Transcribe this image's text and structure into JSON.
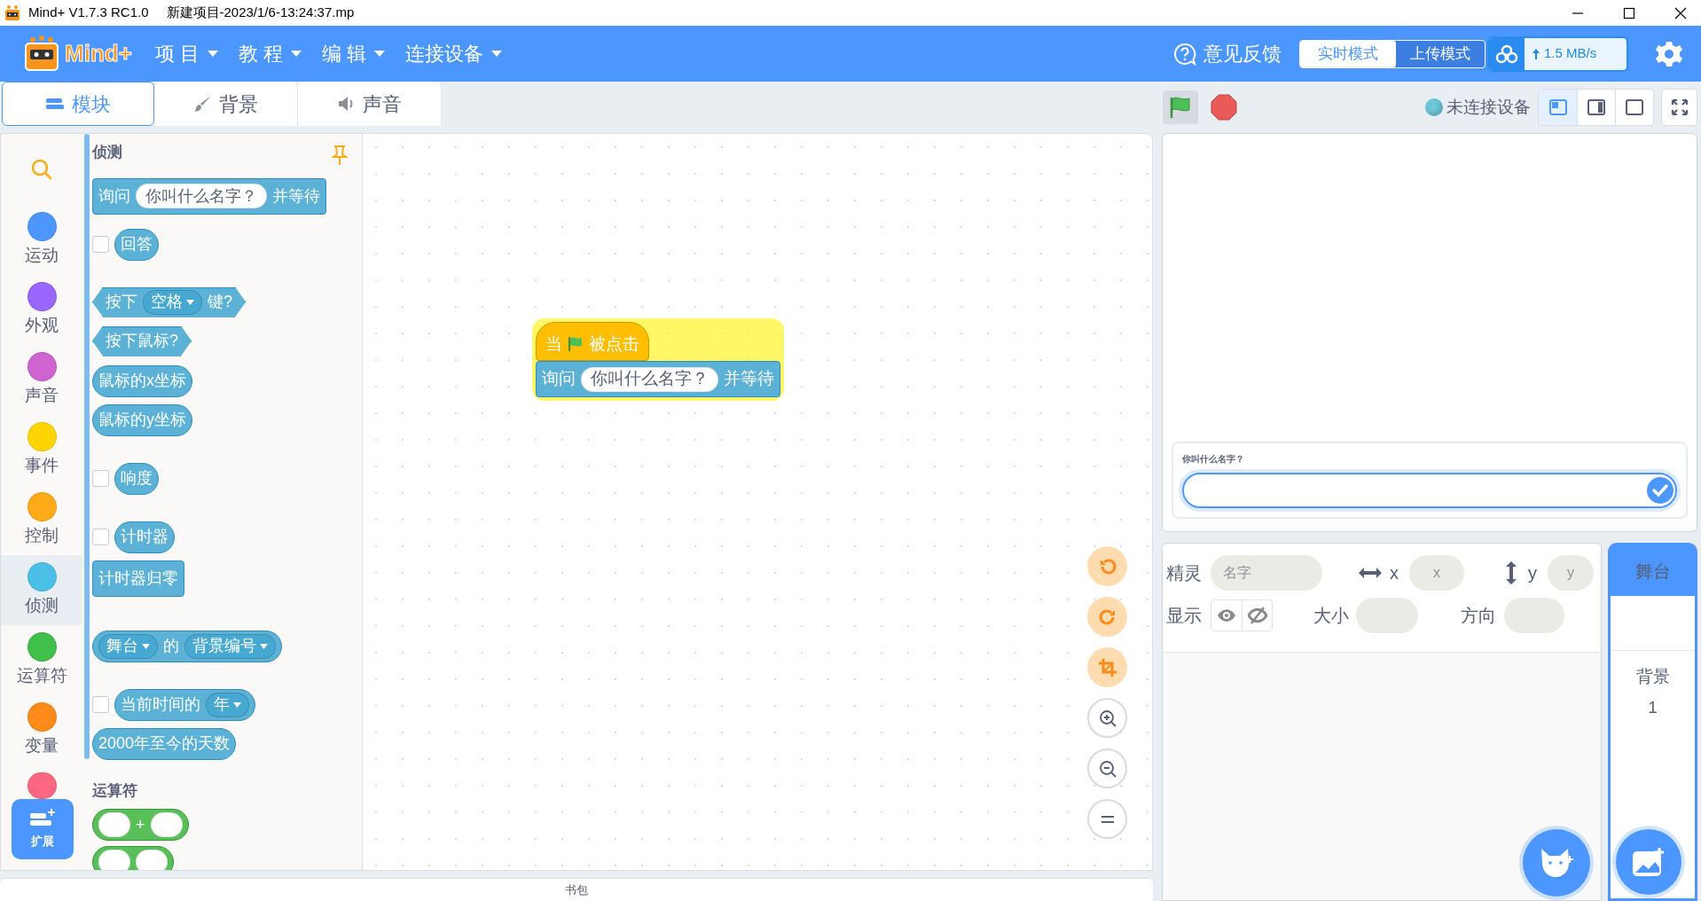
{
  "title_bar": {
    "app_title": "Mind+ V1.7.3 RC1.0",
    "project_title": "新建项目-2023/1/6-13:24:37.mp"
  },
  "header": {
    "logo": "Mind+",
    "menus": [
      {
        "label": "项 目"
      },
      {
        "label": "教 程"
      },
      {
        "label": "编 辑"
      },
      {
        "label": "连接设备"
      }
    ],
    "feedback": "意见反馈",
    "modes": [
      {
        "label": "实时模式",
        "selected": true
      },
      {
        "label": "上传模式",
        "selected": false
      }
    ],
    "network_speed": "1.5 MB/s"
  },
  "editor_tabs": [
    {
      "label": "模块",
      "selected": true
    },
    {
      "label": "背景",
      "selected": false
    },
    {
      "label": "声音",
      "selected": false
    }
  ],
  "categories": [
    {
      "label": "运动",
      "color": "#4c97ff",
      "selected": false
    },
    {
      "label": "外观",
      "color": "#9966ff",
      "selected": false
    },
    {
      "label": "声音",
      "color": "#cf63cf",
      "selected": false
    },
    {
      "label": "事件",
      "color": "#ffd500",
      "selected": false
    },
    {
      "label": "控制",
      "color": "#ffab19",
      "selected": false
    },
    {
      "label": "侦测",
      "color": "#4cbfe6",
      "selected": true
    },
    {
      "label": "运算符",
      "color": "#40bf4a",
      "selected": false
    },
    {
      "label": "变量",
      "color": "#ff8c1a",
      "selected": false
    },
    {
      "color": "#ff6680",
      "selected": false
    }
  ],
  "extension_button": "扩展",
  "palette": [
    {
      "title": "侦测",
      "kind": "sensing",
      "blocks": [
        {
          "kind": "command",
          "parts": [
            {
              "kind": "text",
              "text": "询问"
            },
            {
              "kind": "input",
              "text": "你叫什么名字？"
            },
            {
              "kind": "text",
              "text": "并等待"
            }
          ]
        },
        {
          "kind": "reporter",
          "checkbox": {
            "checked": false
          },
          "parts": [
            {
              "kind": "text",
              "text": "回答"
            }
          ]
        },
        {
          "kind": "boolean",
          "parts": [
            {
              "kind": "text",
              "text": "按下"
            },
            {
              "kind": "dropdown",
              "text": "空格"
            },
            {
              "kind": "text",
              "text": "键?"
            }
          ]
        },
        {
          "kind": "boolean",
          "parts": [
            {
              "kind": "text",
              "text": "按下鼠标?"
            }
          ]
        },
        {
          "kind": "reporter",
          "parts": [
            {
              "kind": "text",
              "text": "鼠标的x坐标"
            }
          ]
        },
        {
          "kind": "reporter",
          "parts": [
            {
              "kind": "text",
              "text": "鼠标的y坐标"
            }
          ]
        },
        {
          "kind": "reporter",
          "checkbox": {
            "checked": false
          },
          "parts": [
            {
              "kind": "text",
              "text": "响度"
            }
          ]
        },
        {
          "kind": "reporter",
          "checkbox": {
            "checked": false
          },
          "parts": [
            {
              "kind": "text",
              "text": "计时器"
            }
          ]
        },
        {
          "kind": "command",
          "parts": [
            {
              "kind": "text",
              "text": "计时器归零"
            }
          ]
        },
        {
          "kind": "reporter",
          "parts": [
            {
              "kind": "dropdown",
              "text": "舞台"
            },
            {
              "kind": "text",
              "text": "的"
            },
            {
              "kind": "dropdown",
              "text": "背景编号"
            }
          ]
        },
        {
          "kind": "reporter",
          "checkbox": {
            "checked": false
          },
          "parts": [
            {
              "kind": "text",
              "text": "当前时间的"
            },
            {
              "kind": "dropdown",
              "text": "年"
            }
          ]
        },
        {
          "kind": "reporter",
          "parts": [
            {
              "kind": "text",
              "text": "2000年至今的天数"
            }
          ]
        }
      ]
    },
    {
      "title": "运算符",
      "kind": "operators",
      "blocks": [
        {
          "kind": "reporter",
          "parts": [
            {
              "kind": "input"
            },
            {
              "kind": "text",
              "text": "+"
            },
            {
              "kind": "input"
            }
          ]
        },
        {
          "kind": "reporter",
          "parts": [
            {
              "kind": "input"
            },
            {
              "kind": "input"
            }
          ]
        }
      ]
    }
  ],
  "script": {
    "glowing": true,
    "blocks": [
      {
        "kind": "hat",
        "parts": [
          {
            "kind": "text",
            "text": "当"
          },
          {
            "kind": "flag"
          },
          {
            "kind": "text",
            "text": "被点击"
          }
        ]
      },
      {
        "kind": "command",
        "parts": [
          {
            "kind": "text",
            "text": "询问"
          },
          {
            "kind": "input",
            "text": "你叫什么名字？"
          },
          {
            "kind": "text",
            "text": "并等待"
          }
        ]
      }
    ]
  },
  "backpack": "书包",
  "stage_bar": {
    "connected": false,
    "status": "未连接设备"
  },
  "stage": {
    "ask_question": "你叫什么名字？"
  },
  "sprite_info": {
    "sprite_label": "精灵",
    "name_placeholder": "名字",
    "x_label": "x",
    "x_placeholder": "x",
    "y_label": "y",
    "y_placeholder": "y",
    "show_label": "显示",
    "size_label": "大小",
    "direction_label": "方向"
  },
  "stage_panel": {
    "title": "舞台",
    "backdrop_label": "背景",
    "backdrop_count": "1"
  }
}
